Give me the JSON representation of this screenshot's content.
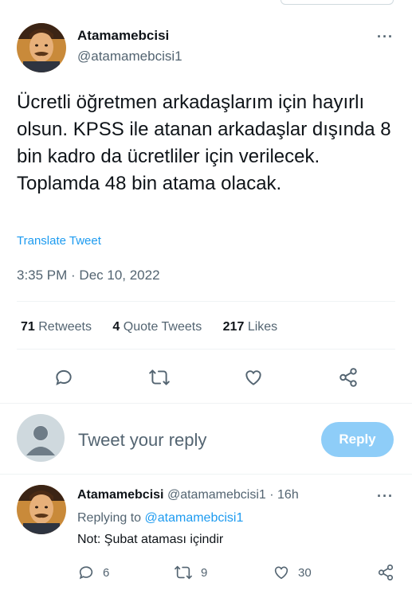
{
  "tweet": {
    "display_name": "Atamamebcisi",
    "handle": "@atamamebcisi1",
    "text": "Ücretli öğretmen arkadaşlarım için hayırlı olsun. KPSS ile atanan arkadaşlar dışında 8 bin kadro da ücretliler için verilecek. Toplamda 48 bin atama olacak.",
    "translate_label": "Translate Tweet",
    "timestamp": "3:35 PM · Dec 10, 2022",
    "stats": {
      "retweets_count": "71",
      "retweets_label": "Retweets",
      "quotes_count": "4",
      "quotes_label": "Quote Tweets",
      "likes_count": "217",
      "likes_label": "Likes"
    },
    "more_label": "···"
  },
  "composer": {
    "placeholder": "Tweet your reply",
    "reply_button": "Reply"
  },
  "reply": {
    "display_name": "Atamamebcisi",
    "handle_time": "@atamamebcisi1 · 16h",
    "replying_prefix": "Replying to",
    "replying_handle": "@atamamebcisi1",
    "text": "Not: Şubat ataması içindir",
    "more_label": "···",
    "actions": {
      "replies": "6",
      "retweets": "9",
      "likes": "30"
    }
  },
  "colors": {
    "accent": "#1d9bf0",
    "reply_button_disabled": "#8ecdf8",
    "secondary_text": "#536471"
  },
  "icons": [
    "reply-icon",
    "retweet-icon",
    "like-icon",
    "share-icon",
    "more-icon",
    "avatar"
  ]
}
